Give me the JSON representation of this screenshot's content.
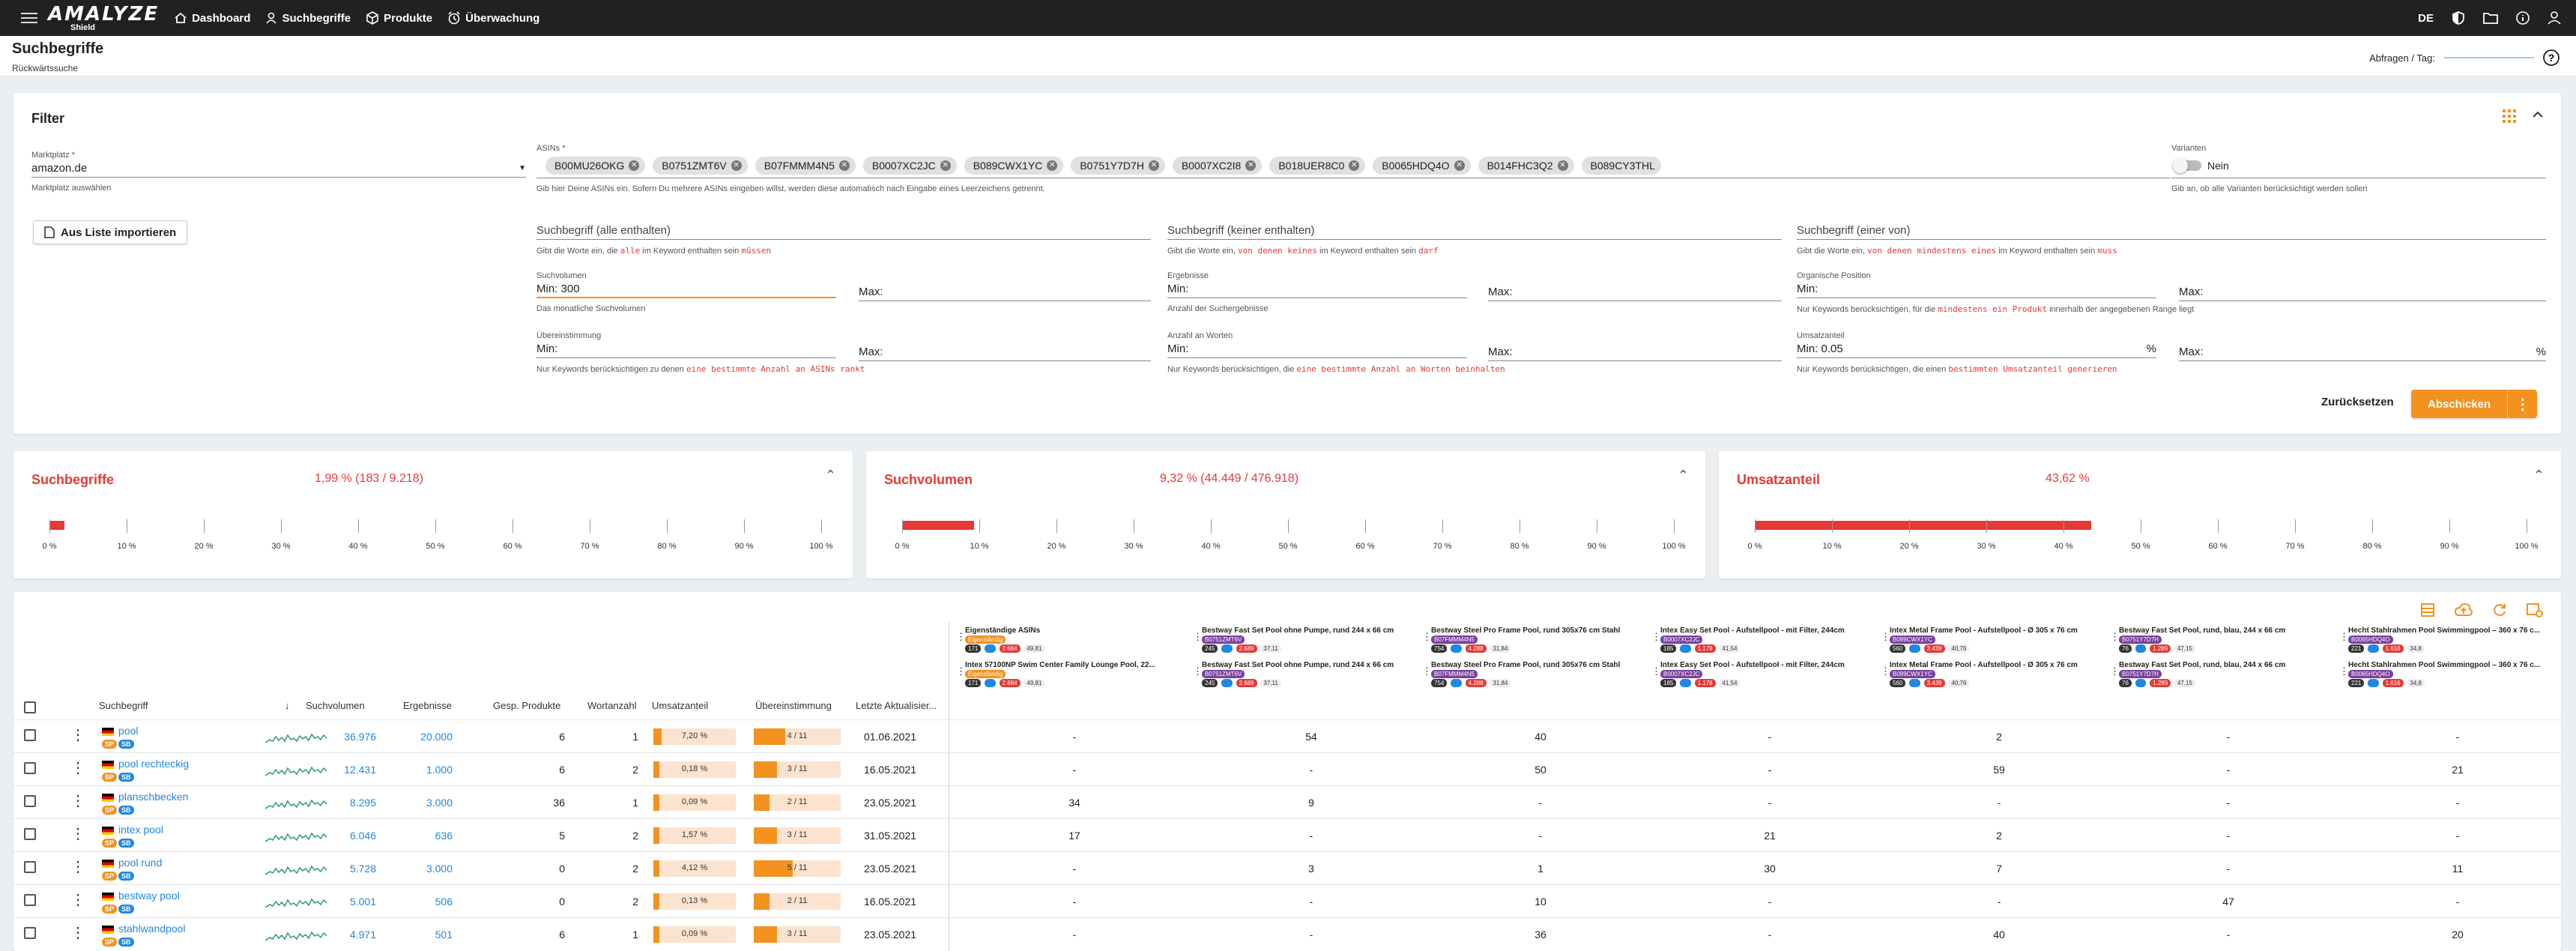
{
  "topbar": {
    "logo": "AMALYZE",
    "logo_sub": "Shield",
    "nav": [
      {
        "label": "Dashboard",
        "icon": "home-icon"
      },
      {
        "label": "Suchbegriffe",
        "icon": "person-search-icon"
      },
      {
        "label": "Produkte",
        "icon": "box-icon"
      },
      {
        "label": "Überwachung",
        "icon": "alarm-icon"
      }
    ],
    "lang": "DE"
  },
  "page": {
    "title": "Suchbegriffe",
    "subtitle": "Rückwärtssuche",
    "abfragen_label": "Abfragen / Tag:"
  },
  "filter": {
    "title": "Filter",
    "marketplace": {
      "label": "Marktplatz *",
      "value": "amazon.de",
      "hint": "Marktplatz auswählen"
    },
    "asins": {
      "label": "ASINs *",
      "items": [
        "B00MU26OKG",
        "B0751ZMT6V",
        "B07FMMM4N5",
        "B0007XC2JC",
        "B089CWX1YC",
        "B0751Y7D7H",
        "B0007XC2I8",
        "B018UER8C0",
        "B0065HDQ4O",
        "B014FHC3Q2",
        "B089CY3THL"
      ],
      "hint": "Gib hier Deine ASINs ein. Sofern Du mehrere ASINs eingeben willst, werden diese automatisch nach Eingabe eines Leerzeichens getrennt."
    },
    "varianten": {
      "label": "Varianten",
      "value": "Nein",
      "hint": "Gib an, ob alle Varianten berücksichtigt werden sollen"
    },
    "import_button": "Aus Liste importieren",
    "sb_all": {
      "label": "Suchbegriff (alle enthalten)",
      "hint_a": "Gibt die Worte ein, die",
      "code": "alle",
      "hint_b": "im Keyword enthalten sein",
      "code2": "müssen"
    },
    "sb_none": {
      "label": "Suchbegriff (keiner enthalten)",
      "hint_a": "Gibt die Worte ein,",
      "code": "von denen keines",
      "hint_b": "im Keyword enthalten sein",
      "code2": "darf"
    },
    "sb_one": {
      "label": "Suchbegriff (einer von)",
      "hint_a": "Gibt die Worte ein,",
      "code": "von denen mindestens eines",
      "hint_b": "im Keyword enthalten sein",
      "code2": "muss"
    },
    "min": "Min:",
    "max": "Max:",
    "suchvolumen": {
      "label": "Suchvolumen",
      "min_value": "300",
      "hint": "Das monatliche Suchvolumen"
    },
    "ergebnisse": {
      "label": "Ergebnisse",
      "hint": "Anzahl der Suchergebnisse"
    },
    "organische": {
      "label": "Organische Position",
      "hint_a": "Nur Keywords berücksichtigen, für die",
      "code": "mindestens ein Produkt",
      "hint_b": "innerhalb der angegebenen Range liegt"
    },
    "uebereinstimmung": {
      "label": "Übereinstimmung",
      "hint_a": "Nur Keywords berücksichtigen zu denen",
      "code": "eine bestimmte Anzahl an ASINs rankt"
    },
    "wortanzahl": {
      "label": "Anzahl an Worten",
      "hint_a": "Nur Keywords berücksichtigen, die",
      "code": "eine bestimmte Anzahl an Worten beinhalten"
    },
    "umsatzanteil": {
      "label": "Umsatzanteil",
      "min_value": "0.05",
      "unit": "%",
      "hint_a": "Nur Keywords berücksichtigen, die einen",
      "code": "bestimmten Umsatzanteil generieren"
    },
    "reset_button": "Zurücksetzen",
    "submit_button": "Abschicken"
  },
  "stats": [
    {
      "title": "Suchbegriffe",
      "value": "1,99 % (183 / 9.218)",
      "fraction": 0.0199
    },
    {
      "title": "Suchvolumen",
      "value": "9,32 % (44.449 / 476.918)",
      "fraction": 0.0932
    },
    {
      "title": "Umsatzanteil",
      "value": "43,62 %",
      "fraction": 0.4362
    }
  ],
  "ticks": [
    "0 %",
    "10 %",
    "20 %",
    "30 %",
    "40 %",
    "50 %",
    "60 %",
    "70 %",
    "80 %",
    "90 %",
    "100 %"
  ],
  "table": {
    "headers": {
      "suchbegriff": "Suchbegriff",
      "suchvolumen": "Suchvolumen",
      "ergebnisse": "Ergebnisse",
      "gesp": "Gesp. Produkte",
      "wortanzahl": "Wortanzahl",
      "umsatzanteil": "Umsatzanteil",
      "uebereinstimmung": "Übereinstimmung",
      "letzte": "Letzte Aktualisier..."
    },
    "asin_columns": [
      {
        "name": "Eigenständige ASINs",
        "name2": "Intex 57100NP Swim Center Family Lounge Pool, 22...",
        "b1": "Eigenständig",
        "n1": "171",
        "n2": "2.684",
        "n3": "49,81"
      },
      {
        "name": "Bestway Fast Set Pool ohne Pumpe, rund 244 x 66 cm",
        "name2": "Bestway Fast Set Pool ohne Pumpe, rund 244 x 66 cm",
        "b1": "B0751ZMT6V",
        "n1": "245",
        "n2": "2.689",
        "n3": "37,11"
      },
      {
        "name": "Bestway Steel Pro Frame Pool, rund 305x76 cm Stahl",
        "name2": "Bestway Steel Pro Frame Pool, rund 305x76 cm Stahl",
        "b1": "B07FMMM4N5",
        "n1": "754",
        "n2": "4.288",
        "n3": "31,84"
      },
      {
        "name": "Intex Easy Set Pool - Aufstellpool - mit Filter, 244cm",
        "name2": "Intex Easy Set Pool - Aufstellpool - mit Filter, 244cm",
        "b1": "B0007XC2JC",
        "n1": "185",
        "n2": "1.178",
        "n3": "41,54"
      },
      {
        "name": "Intex Metal Frame Pool - Aufstellpool - Ø 305 x 76 cm",
        "name2": "Intex Metal Frame Pool - Aufstellpool - Ø 305 x 76 cm",
        "b1": "B089CWX1YC",
        "n1": "560",
        "n2": "3.439",
        "n3": "40,76"
      },
      {
        "name": "Bestway Fast Set Pool, rund, blau, 244 x 66 cm",
        "name2": "Bestway Fast Set Pool, rund, blau, 244 x 66 cm",
        "b1": "B0751Y7D7H",
        "n1": "76",
        "n2": "1.289",
        "n3": "47,15"
      },
      {
        "name": "Hecht Stahlrahmen Pool Swimmingpool – 360 x 76 c...",
        "name2": "Hecht Stahlrahmen Pool Swimmingpool – 360 x 76 c...",
        "b1": "B0065HDQ4O",
        "n1": "221",
        "n2": "1.616",
        "n3": "34,8"
      }
    ],
    "rows": [
      {
        "kw": "pool",
        "b1": "SP",
        "b2": "SB",
        "vol": "36.976",
        "erg": "20.000",
        "gesp": "6",
        "wort": "1",
        "ums": "7,20 %",
        "ums_f": 0.1,
        "ueb": "4 / 11",
        "ueb_f": 0.36,
        "date": "01.06.2021",
        "cells": [
          "-",
          "54",
          "40",
          "-",
          "2",
          "-",
          "-"
        ]
      },
      {
        "kw": "pool rechteckig",
        "b1": "SP",
        "b2": "SB",
        "vol": "12.431",
        "erg": "1.000",
        "gesp": "6",
        "wort": "2",
        "ums": "0,18 %",
        "ums_f": 0.01,
        "ueb": "3 / 11",
        "ueb_f": 0.27,
        "date": "16.05.2021",
        "cells": [
          "-",
          "-",
          "50",
          "-",
          "59",
          "-",
          "21"
        ]
      },
      {
        "kw": "planschbecken",
        "b1": "SP",
        "b2": "SB",
        "vol": "8.295",
        "erg": "3.000",
        "gesp": "36",
        "wort": "1",
        "ums": "0,09 %",
        "ums_f": 0.01,
        "ueb": "2 / 11",
        "ueb_f": 0.18,
        "date": "23.05.2021",
        "cells": [
          "34",
          "9",
          "-",
          "-",
          "-",
          "-",
          "-"
        ]
      },
      {
        "kw": "intex pool",
        "b1": "SP",
        "b2": "SB",
        "vol": "6.046",
        "erg": "636",
        "gesp": "5",
        "wort": "2",
        "ums": "1,57 %",
        "ums_f": 0.03,
        "ueb": "3 / 11",
        "ueb_f": 0.27,
        "date": "31.05.2021",
        "cells": [
          "17",
          "-",
          "-",
          "21",
          "2",
          "-",
          "-"
        ]
      },
      {
        "kw": "pool rund",
        "b1": "SP",
        "b2": "SB",
        "vol": "5.728",
        "erg": "3.000",
        "gesp": "0",
        "wort": "2",
        "ums": "4,12 %",
        "ums_f": 0.06,
        "ueb": "5 / 11",
        "ueb_f": 0.45,
        "date": "23.05.2021",
        "cells": [
          "-",
          "3",
          "1",
          "30",
          "7",
          "-",
          "11"
        ]
      },
      {
        "kw": "bestway pool",
        "b1": "SP",
        "b2": "SB",
        "vol": "5.001",
        "erg": "506",
        "gesp": "0",
        "wort": "2",
        "ums": "0,13 %",
        "ums_f": 0.01,
        "ueb": "2 / 11",
        "ueb_f": 0.18,
        "date": "16.05.2021",
        "cells": [
          "-",
          "-",
          "10",
          "-",
          "-",
          "47",
          "-"
        ]
      },
      {
        "kw": "stahlwandpool",
        "b1": "SP",
        "b2": "SB",
        "vol": "4.971",
        "erg": "501",
        "gesp": "6",
        "wort": "1",
        "ums": "0,09 %",
        "ums_f": 0.01,
        "ueb": "3 / 11",
        "ueb_f": 0.27,
        "date": "23.05.2021",
        "cells": [
          "-",
          "-",
          "36",
          "-",
          "40",
          "-",
          "20"
        ]
      }
    ]
  }
}
